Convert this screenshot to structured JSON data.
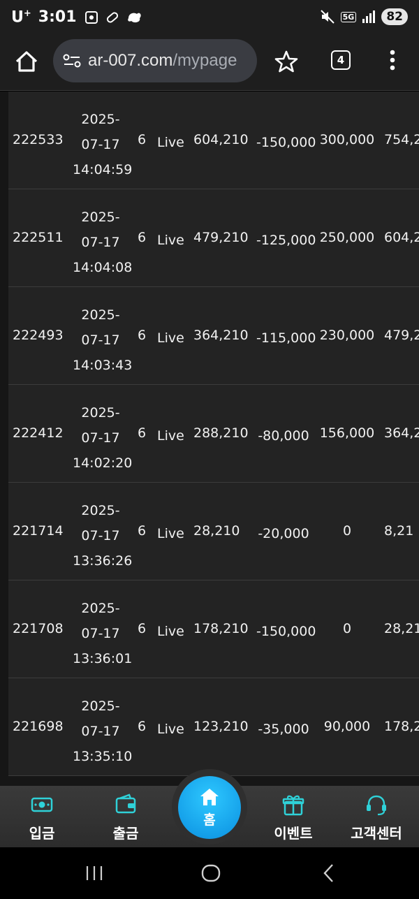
{
  "status_bar": {
    "carrier": "U",
    "carrier_sup": "+",
    "time": "3:01",
    "network": "5G",
    "battery": "82"
  },
  "browser": {
    "url_domain": "ar-007.com",
    "url_path": "/mypage",
    "tab_count": "4"
  },
  "table": {
    "rows": [
      {
        "id": "222533",
        "date": "2025-",
        "month_day": "07-17",
        "time": "14:04:59",
        "count": "6",
        "type": "Live",
        "amount": "604,210",
        "change": "-150,000",
        "bonus": "300,000",
        "balance": "754,2"
      },
      {
        "id": "222511",
        "date": "2025-",
        "month_day": "07-17",
        "time": "14:04:08",
        "count": "6",
        "type": "Live",
        "amount": "479,210",
        "change": "-125,000",
        "bonus": "250,000",
        "balance": "604,2"
      },
      {
        "id": "222493",
        "date": "2025-",
        "month_day": "07-17",
        "time": "14:03:43",
        "count": "6",
        "type": "Live",
        "amount": "364,210",
        "change": "-115,000",
        "bonus": "230,000",
        "balance": "479,2"
      },
      {
        "id": "222412",
        "date": "2025-",
        "month_day": "07-17",
        "time": "14:02:20",
        "count": "6",
        "type": "Live",
        "amount": "288,210",
        "change": "-80,000",
        "bonus": "156,000",
        "balance": "364,2"
      },
      {
        "id": "221714",
        "date": "2025-",
        "month_day": "07-17",
        "time": "13:36:26",
        "count": "6",
        "type": "Live",
        "amount": "28,210",
        "change": "-20,000",
        "bonus": "0",
        "balance": "8,21"
      },
      {
        "id": "221708",
        "date": "2025-",
        "month_day": "07-17",
        "time": "13:36:01",
        "count": "6",
        "type": "Live",
        "amount": "178,210",
        "change": "-150,000",
        "bonus": "0",
        "balance": "28,21"
      },
      {
        "id": "221698",
        "date": "2025-",
        "month_day": "07-17",
        "time": "13:35:10",
        "count": "6",
        "type": "Live",
        "amount": "123,210",
        "change": "-35,000",
        "bonus": "90,000",
        "balance": "178,2"
      }
    ]
  },
  "bottom_nav": {
    "deposit": "입금",
    "withdraw": "출금",
    "home": "홈",
    "event": "이벤트",
    "support": "고객센터"
  },
  "colors": {
    "accent": "#2ec8ff",
    "icon_teal": "#2fd1d8"
  }
}
